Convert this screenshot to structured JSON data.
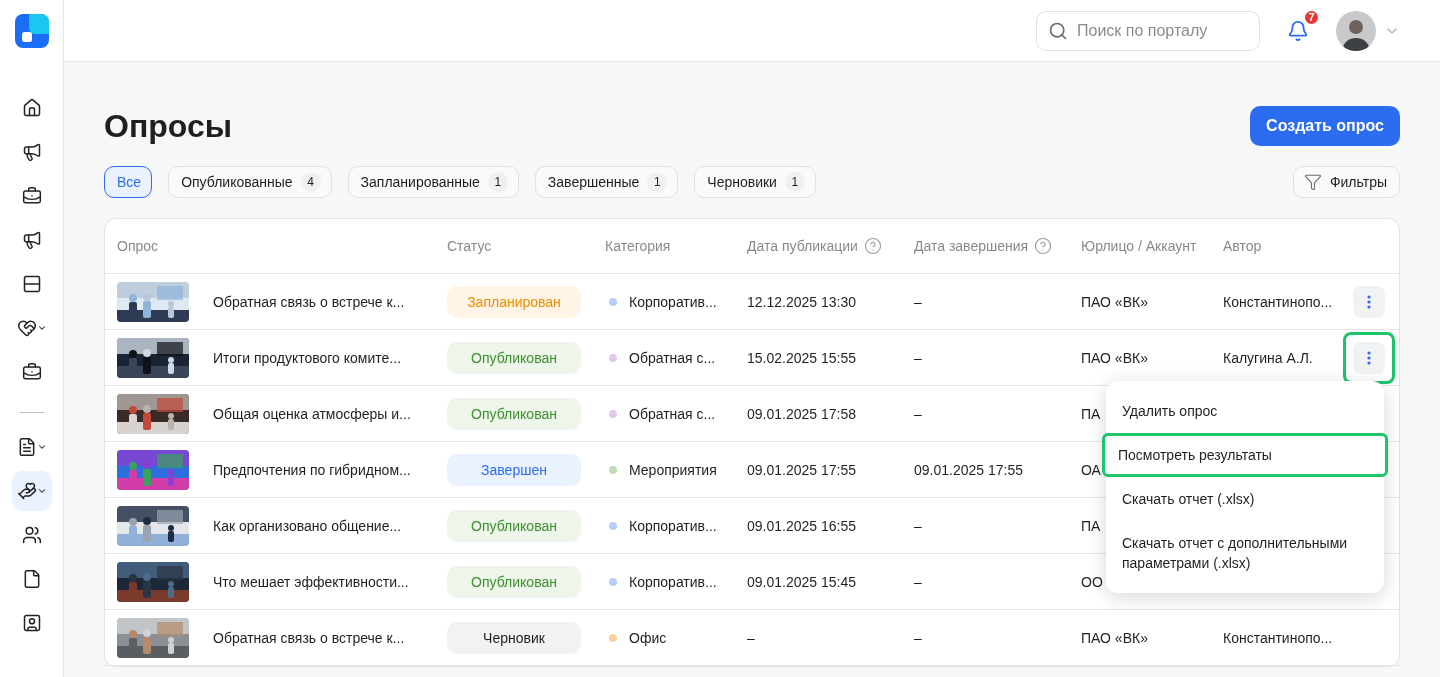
{
  "sidebar": {
    "groups": [
      {
        "items": [
          {
            "selected": false,
            "submenu": false
          },
          {
            "selected": false,
            "submenu": false
          },
          {
            "selected": false,
            "submenu": false
          },
          {
            "selected": false,
            "submenu": false
          },
          {
            "selected": false,
            "submenu": false
          },
          {
            "selected": false,
            "submenu": true
          },
          {
            "selected": false,
            "submenu": false
          }
        ]
      },
      {
        "items": [
          {
            "selected": false,
            "submenu": true
          },
          {
            "selected": true,
            "submenu": true
          },
          {
            "selected": false,
            "submenu": false
          },
          {
            "selected": false,
            "submenu": false
          },
          {
            "selected": false,
            "submenu": false
          }
        ]
      }
    ]
  },
  "header": {
    "search": {
      "placeholder": "Поиск по порталу"
    },
    "notifications": {
      "badge": "7"
    }
  },
  "page": {
    "title": "Опросы",
    "create_button": "Создать опрос",
    "filters_button": "Фильтры"
  },
  "chips": [
    {
      "label": "Все",
      "selected": true
    },
    {
      "label": "Опубликованные",
      "count": "4",
      "selected": false
    },
    {
      "label": "Запланированные",
      "count": "1",
      "selected": false
    },
    {
      "label": "Завершенные",
      "count": "1",
      "selected": false
    },
    {
      "label": "Черновики",
      "count": "1",
      "selected": false
    }
  ],
  "table": {
    "columns": [
      {
        "label": "Опрос"
      },
      {
        "label": "Статус"
      },
      {
        "label": "Категория"
      },
      {
        "label": "Дата публикации",
        "help": true
      },
      {
        "label": "Дата завершения",
        "help": true
      },
      {
        "label": "Юрлицо / Аккаунт"
      },
      {
        "label": "Автор"
      }
    ],
    "rows": [
      {
        "title": "Обратная связь о встрече к...",
        "status": {
          "label": "Запланирован",
          "kind": "scheduled"
        },
        "category": {
          "label": "Корпоратив...",
          "color": "#b5d0f5"
        },
        "published": "12.12.2025 13:30",
        "finished": "–",
        "entity": "ПАО «ВК»",
        "author": "Константинопо...",
        "menu_button": true
      },
      {
        "title": "Итоги продуктового комите...",
        "status": {
          "label": "Опубликован",
          "kind": "published"
        },
        "category": {
          "label": "Обратная с...",
          "color": "#e2c8f0"
        },
        "published": "15.02.2025 15:55",
        "finished": "–",
        "entity": "ПАО «ВК»",
        "author": "Калугина А.Л.",
        "menu_button": true,
        "highlighted": true
      },
      {
        "title": "Общая оценка атмосферы и...",
        "status": {
          "label": "Опубликован",
          "kind": "published"
        },
        "category": {
          "label": "Обратная с...",
          "color": "#e2c8f0"
        },
        "published": "09.01.2025 17:58",
        "finished": "–",
        "entity": "ПА"
      },
      {
        "title": "Предпочтения по гибридном...",
        "status": {
          "label": "Завершен",
          "kind": "finished"
        },
        "category": {
          "label": "Мероприятия",
          "color": "#bfdcb0"
        },
        "published": "09.01.2025 17:55",
        "finished": "09.01.2025 17:55",
        "entity": "ОА"
      },
      {
        "title": "Как организовано общение...",
        "status": {
          "label": "Опубликован",
          "kind": "published"
        },
        "category": {
          "label": "Корпоратив...",
          "color": "#b5d0f5"
        },
        "published": "09.01.2025 16:55",
        "finished": "–",
        "entity": "ПА"
      },
      {
        "title": "Что мешает эффективности...",
        "status": {
          "label": "Опубликован",
          "kind": "published"
        },
        "category": {
          "label": "Корпоратив...",
          "color": "#b5d0f5"
        },
        "published": "09.01.2025 15:45",
        "finished": "–",
        "entity": "ОО"
      },
      {
        "title": "Обратная связь о встрече к...",
        "status": {
          "label": "Черновик",
          "kind": "draft"
        },
        "category": {
          "label": "Офис",
          "color": "#fad09a"
        },
        "published": "–",
        "finished": "–",
        "entity": "ПАО «ВК»",
        "author": "Константинопо..."
      }
    ]
  },
  "row_menu": {
    "items": [
      {
        "label": "Удалить опрос",
        "highlighted": false
      },
      {
        "label": "Посмотреть результаты",
        "highlighted": true
      },
      {
        "label": "Скачать отчет (.xlsx)",
        "highlighted": false
      },
      {
        "label": "Скачать отчет с дополнительными параметрами (.xlsx)",
        "highlighted": false
      }
    ]
  }
}
